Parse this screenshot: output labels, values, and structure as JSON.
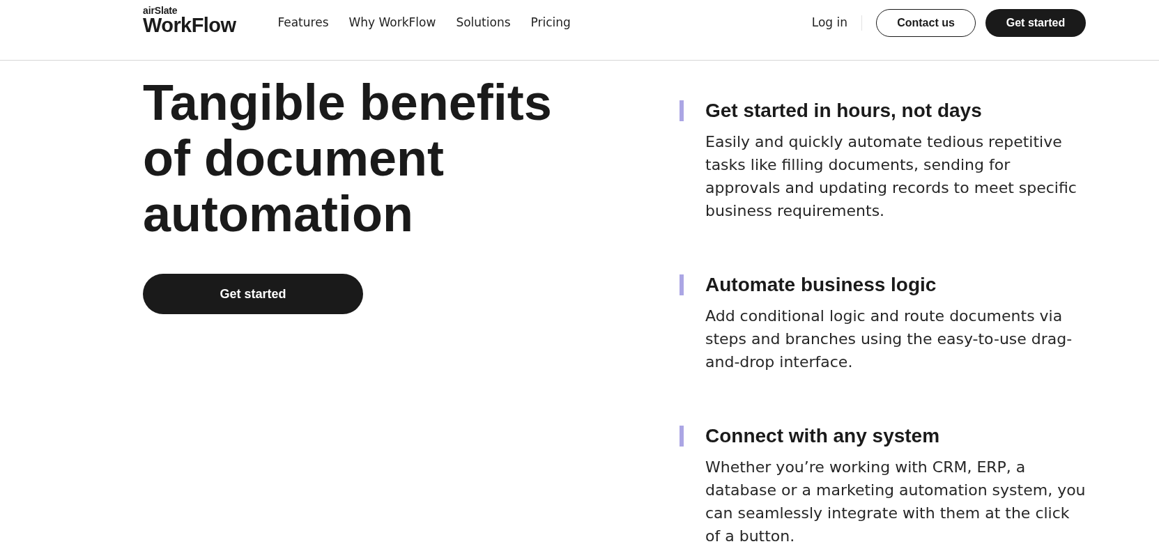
{
  "header": {
    "logo": {
      "small": "airSlate",
      "large": "WorkFlow"
    },
    "nav": [
      "Features",
      "Why WorkFlow",
      "Solutions",
      "Pricing"
    ],
    "login": "Log in",
    "buttons": [
      {
        "label": "Contact us",
        "kind": "outline"
      },
      {
        "label": "Get started",
        "kind": "filled"
      }
    ]
  },
  "hero": {
    "title": "Tangible benefits of document automation",
    "button": "Get started"
  },
  "benefits": [
    {
      "title": "Get started in hours, not days",
      "text": "Easily and quickly automate tedious repetitive tasks like filling documents, sending for approvals and updating records to meet specific business requirements."
    },
    {
      "title": "Automate business logic",
      "text": "Add conditional logic and route documents via steps and branches using the easy-to-use drag-and-drop interface."
    },
    {
      "title": "Connect with any system",
      "text": "Whether you’re working with CRM, ERP, a database or a marketing automation system, you can seamlessly integrate with them at the click of a button."
    }
  ]
}
